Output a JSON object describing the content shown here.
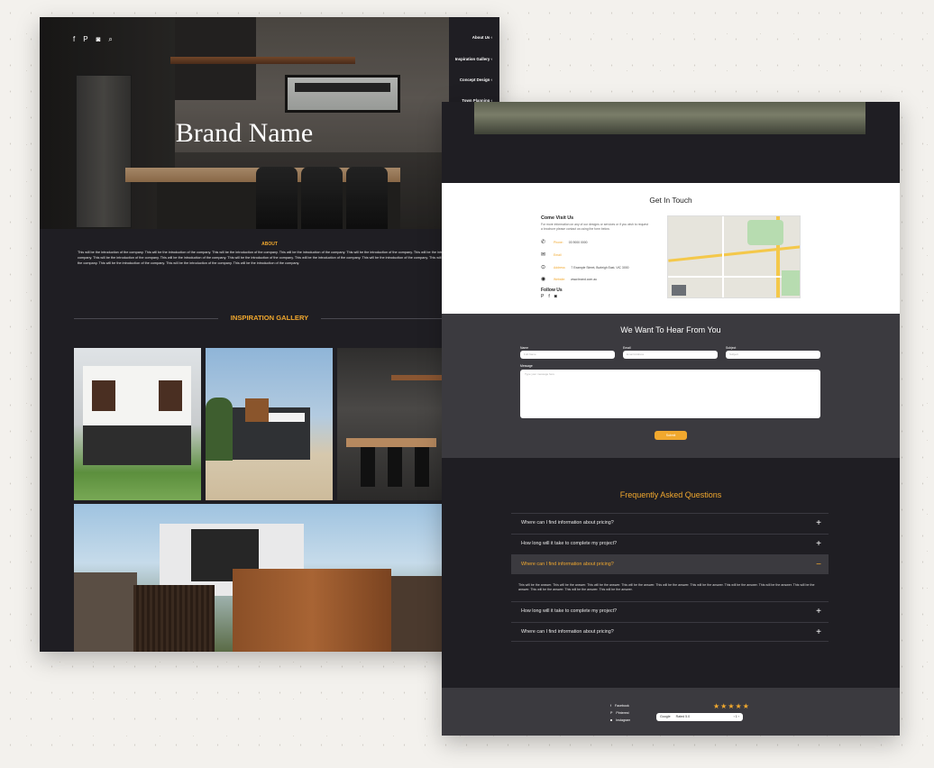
{
  "hero": {
    "brand_name": "Brand Name",
    "social_icons": [
      "f",
      "P",
      "◙",
      "⌕"
    ]
  },
  "side_menu": [
    {
      "label": "About Us ‹"
    },
    {
      "label": "Inspiration Gallery ‹"
    },
    {
      "label": "Concept Design ‹"
    },
    {
      "label": "Town Planning ‹"
    }
  ],
  "about": {
    "title": "ABOUT",
    "text": "This will be the introduction of the company. This will be the introduction of the company. This will be the introduction of the company. This will be the introduction of the company. This will be the introduction of the company. This will be the introduction of the company. This will be the introduction of the company. This will be the introduction of the company. This will be the introduction of the company. This will be the introduction of the company. This will be the introduction of the company. This will be the introduction of the company. This will be the introduction of the company. This will be the introduction of the company. This will be the introduction of the company."
  },
  "gallery": {
    "title": "INSPIRATION GALLERY"
  },
  "contact": {
    "title": "Get In Touch",
    "visit_title": "Come Visit Us",
    "visit_text": "For more information on any of our designs or services or if you wish to request a brochure please contact us using the form below.",
    "phone_label": "Phone:",
    "phone": "03 9000 0000",
    "email_label": "Email",
    "address_label": "Address:",
    "address": "7 Example Street, Burleigh East, VIC 3000",
    "website_label": "Website:",
    "website": "www.brand.com.au",
    "follow_title": "Follow Us",
    "follow_icons": [
      "P",
      "f",
      "◙"
    ]
  },
  "form": {
    "title": "We Want To Hear From You",
    "name_label": "Name",
    "name_placeholder": "Full Name",
    "email_label": "Email",
    "email_placeholder": "Email Address",
    "subject_label": "Subject",
    "subject_placeholder": "Subject",
    "message_label": "Message",
    "message_placeholder": "Type your message here",
    "submit_label": "Submit"
  },
  "faq": {
    "title": "Frequently Asked Questions",
    "items": [
      {
        "q": "Where can I find information about pricing?"
      },
      {
        "q": "How long will it take to complete my project?"
      },
      {
        "q": "Where can I find information about pricing?"
      },
      {
        "q": "How long will it take to complete my project?"
      },
      {
        "q": "Where can I find information about pricing?"
      }
    ],
    "open_answer": "This will be the answer. This will be the answer. This will be the answer. This will be the answer. This will be the answer. This will be the answer. This will be the answer. This will be the answer. This will be the answer. This will be the answer. This will be the answer. This will be the answer."
  },
  "footer": {
    "links": [
      "Facebook",
      "Pinterest",
      "Instagram"
    ],
    "stars": "★★★★★",
    "google_label": "Google",
    "google_text": "Rated 5.0",
    "google_nav": "‹ 1 ›"
  },
  "colors": {
    "accent": "#f1a82e",
    "dark": "#1f1e23",
    "panel": "#3b3a3f"
  }
}
